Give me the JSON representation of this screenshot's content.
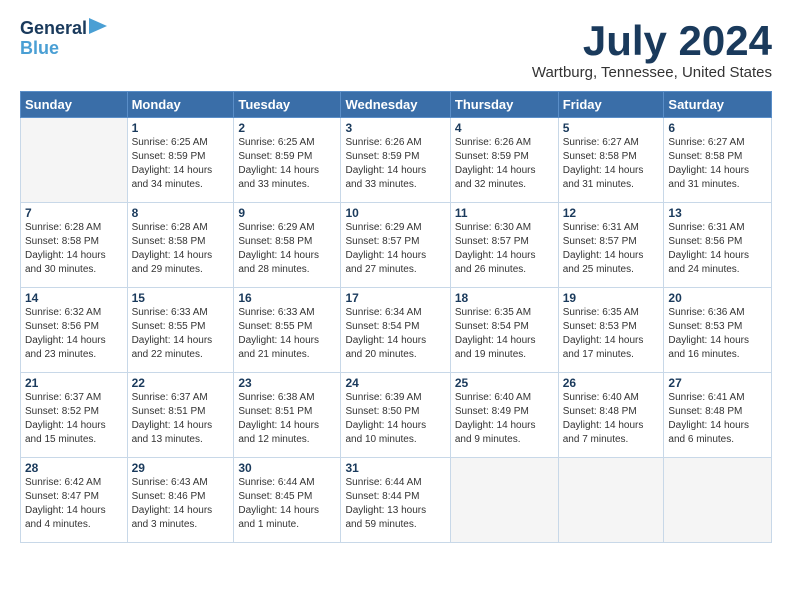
{
  "header": {
    "logo_line1": "General",
    "logo_line2": "Blue",
    "month": "July 2024",
    "location": "Wartburg, Tennessee, United States"
  },
  "days_of_week": [
    "Sunday",
    "Monday",
    "Tuesday",
    "Wednesday",
    "Thursday",
    "Friday",
    "Saturday"
  ],
  "weeks": [
    [
      {
        "day": "",
        "info": ""
      },
      {
        "day": "1",
        "info": "Sunrise: 6:25 AM\nSunset: 8:59 PM\nDaylight: 14 hours\nand 34 minutes."
      },
      {
        "day": "2",
        "info": "Sunrise: 6:25 AM\nSunset: 8:59 PM\nDaylight: 14 hours\nand 33 minutes."
      },
      {
        "day": "3",
        "info": "Sunrise: 6:26 AM\nSunset: 8:59 PM\nDaylight: 14 hours\nand 33 minutes."
      },
      {
        "day": "4",
        "info": "Sunrise: 6:26 AM\nSunset: 8:59 PM\nDaylight: 14 hours\nand 32 minutes."
      },
      {
        "day": "5",
        "info": "Sunrise: 6:27 AM\nSunset: 8:58 PM\nDaylight: 14 hours\nand 31 minutes."
      },
      {
        "day": "6",
        "info": "Sunrise: 6:27 AM\nSunset: 8:58 PM\nDaylight: 14 hours\nand 31 minutes."
      }
    ],
    [
      {
        "day": "7",
        "info": "Sunrise: 6:28 AM\nSunset: 8:58 PM\nDaylight: 14 hours\nand 30 minutes."
      },
      {
        "day": "8",
        "info": "Sunrise: 6:28 AM\nSunset: 8:58 PM\nDaylight: 14 hours\nand 29 minutes."
      },
      {
        "day": "9",
        "info": "Sunrise: 6:29 AM\nSunset: 8:58 PM\nDaylight: 14 hours\nand 28 minutes."
      },
      {
        "day": "10",
        "info": "Sunrise: 6:29 AM\nSunset: 8:57 PM\nDaylight: 14 hours\nand 27 minutes."
      },
      {
        "day": "11",
        "info": "Sunrise: 6:30 AM\nSunset: 8:57 PM\nDaylight: 14 hours\nand 26 minutes."
      },
      {
        "day": "12",
        "info": "Sunrise: 6:31 AM\nSunset: 8:57 PM\nDaylight: 14 hours\nand 25 minutes."
      },
      {
        "day": "13",
        "info": "Sunrise: 6:31 AM\nSunset: 8:56 PM\nDaylight: 14 hours\nand 24 minutes."
      }
    ],
    [
      {
        "day": "14",
        "info": "Sunrise: 6:32 AM\nSunset: 8:56 PM\nDaylight: 14 hours\nand 23 minutes."
      },
      {
        "day": "15",
        "info": "Sunrise: 6:33 AM\nSunset: 8:55 PM\nDaylight: 14 hours\nand 22 minutes."
      },
      {
        "day": "16",
        "info": "Sunrise: 6:33 AM\nSunset: 8:55 PM\nDaylight: 14 hours\nand 21 minutes."
      },
      {
        "day": "17",
        "info": "Sunrise: 6:34 AM\nSunset: 8:54 PM\nDaylight: 14 hours\nand 20 minutes."
      },
      {
        "day": "18",
        "info": "Sunrise: 6:35 AM\nSunset: 8:54 PM\nDaylight: 14 hours\nand 19 minutes."
      },
      {
        "day": "19",
        "info": "Sunrise: 6:35 AM\nSunset: 8:53 PM\nDaylight: 14 hours\nand 17 minutes."
      },
      {
        "day": "20",
        "info": "Sunrise: 6:36 AM\nSunset: 8:53 PM\nDaylight: 14 hours\nand 16 minutes."
      }
    ],
    [
      {
        "day": "21",
        "info": "Sunrise: 6:37 AM\nSunset: 8:52 PM\nDaylight: 14 hours\nand 15 minutes."
      },
      {
        "day": "22",
        "info": "Sunrise: 6:37 AM\nSunset: 8:51 PM\nDaylight: 14 hours\nand 13 minutes."
      },
      {
        "day": "23",
        "info": "Sunrise: 6:38 AM\nSunset: 8:51 PM\nDaylight: 14 hours\nand 12 minutes."
      },
      {
        "day": "24",
        "info": "Sunrise: 6:39 AM\nSunset: 8:50 PM\nDaylight: 14 hours\nand 10 minutes."
      },
      {
        "day": "25",
        "info": "Sunrise: 6:40 AM\nSunset: 8:49 PM\nDaylight: 14 hours\nand 9 minutes."
      },
      {
        "day": "26",
        "info": "Sunrise: 6:40 AM\nSunset: 8:48 PM\nDaylight: 14 hours\nand 7 minutes."
      },
      {
        "day": "27",
        "info": "Sunrise: 6:41 AM\nSunset: 8:48 PM\nDaylight: 14 hours\nand 6 minutes."
      }
    ],
    [
      {
        "day": "28",
        "info": "Sunrise: 6:42 AM\nSunset: 8:47 PM\nDaylight: 14 hours\nand 4 minutes."
      },
      {
        "day": "29",
        "info": "Sunrise: 6:43 AM\nSunset: 8:46 PM\nDaylight: 14 hours\nand 3 minutes."
      },
      {
        "day": "30",
        "info": "Sunrise: 6:44 AM\nSunset: 8:45 PM\nDaylight: 14 hours\nand 1 minute."
      },
      {
        "day": "31",
        "info": "Sunrise: 6:44 AM\nSunset: 8:44 PM\nDaylight: 13 hours\nand 59 minutes."
      },
      {
        "day": "",
        "info": ""
      },
      {
        "day": "",
        "info": ""
      },
      {
        "day": "",
        "info": ""
      }
    ]
  ]
}
